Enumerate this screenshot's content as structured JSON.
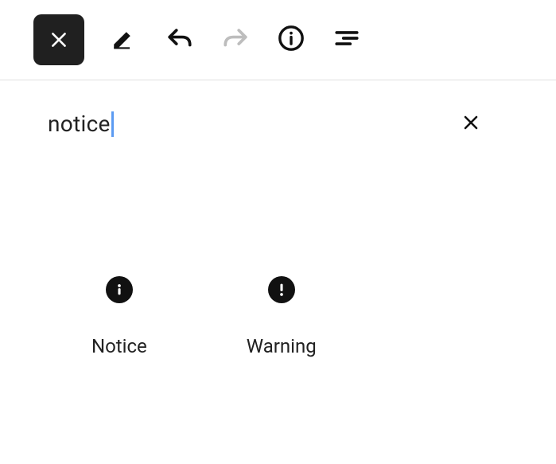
{
  "toolbar": {
    "close_icon": "close",
    "edit_icon": "edit",
    "undo_icon": "undo",
    "redo_icon": "redo",
    "info_icon": "info",
    "filter_icon": "filter"
  },
  "search": {
    "value": "notice",
    "clear_icon": "close"
  },
  "results": [
    {
      "icon": "info-filled",
      "label": "Notice"
    },
    {
      "icon": "warning-filled",
      "label": "Warning"
    }
  ]
}
